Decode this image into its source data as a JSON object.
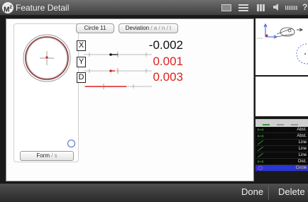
{
  "app": {
    "title": "Feature Detail",
    "logo_text": "M"
  },
  "toolbar": {
    "circle_label": "Circle 11",
    "deviation_label": "Deviation",
    "deviation_modes": " / a / n / t"
  },
  "form": {
    "button_label": "Form",
    "button_mode": " / s"
  },
  "deviations": [
    {
      "axis": "X",
      "value": "-0.002",
      "color": "#111111"
    },
    {
      "axis": "Y",
      "value": "0.001",
      "color": "#e02020"
    },
    {
      "axis": "D",
      "value": "0.003",
      "color": "#e02020"
    }
  ],
  "feature_list": {
    "items": [
      {
        "label": "Abst.",
        "icon": "distance-icon"
      },
      {
        "label": "Abst.",
        "icon": "distance-icon"
      },
      {
        "label": "Line",
        "icon": "line-icon"
      },
      {
        "label": "Line",
        "icon": "line-icon"
      },
      {
        "label": "Line",
        "icon": "line-icon"
      },
      {
        "label": "Dist.",
        "icon": "distance-icon"
      },
      {
        "label": "Circle",
        "icon": "circle-icon",
        "selected": true
      }
    ]
  },
  "actions": {
    "done": "Done",
    "delete": "Delete"
  },
  "colors": {
    "accent": "#2a36d8",
    "deviation": "#e02020",
    "selected_text": "#ffd34a"
  }
}
